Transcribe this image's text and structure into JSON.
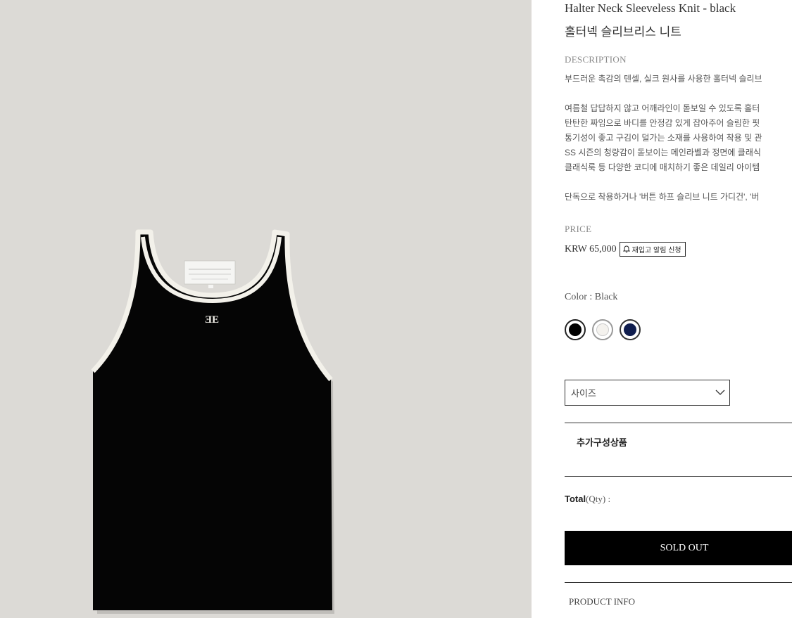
{
  "product": {
    "title_en": "Halter Neck Sleeveless Knit - black",
    "title_ko": "홀터넥 슬리브리스 니트",
    "image_alt": "black halter neck knit top",
    "label_text": "ƎE"
  },
  "description": {
    "heading": "DESCRIPTION",
    "lines": [
      "부드러운 촉감의 텐셀, 실크 원사를 사용한 홀터넥 슬리브",
      "",
      "여름철 답답하지 않고 어깨라인이 돋보일 수 있도록 홀터",
      "탄탄한 짜임으로 바디를 안정감 있게 잡아주어 슬림한 핏",
      "통기성이 좋고 구김이 덜가는 소재를 사용하여 착용 및 관",
      "SS 시즌의 청량감이 돋보이는 메인라벨과 정면에 클래식",
      "클래식룩 등 다양한 코디에 매치하기 좋은 데일리 아이템",
      "",
      "단독으로 착용하거나 '버튼 하프 슬리브 니트 가디건', '버"
    ]
  },
  "price": {
    "heading": "PRICE",
    "value": "KRW 65,000",
    "restock_button": "재입고 알림 신청",
    "restock_icon": "bell-icon"
  },
  "color": {
    "label": "Color : Black",
    "options": [
      {
        "name": "Black",
        "hex": "#000000",
        "selected": true
      },
      {
        "name": "White",
        "hex": "#f4f2ee",
        "selected": false
      },
      {
        "name": "Navy",
        "hex": "#0f1d4e",
        "selected": false
      }
    ]
  },
  "size": {
    "placeholder": "사이즈",
    "icon": "chevron-down-icon"
  },
  "addon": {
    "heading": "추가구성상품"
  },
  "total": {
    "label": "Total",
    "qty_label": "(Qty) :"
  },
  "buttons": {
    "sold_out": "SOLD OUT"
  },
  "product_info": {
    "heading": "PRODUCT INFO"
  },
  "colors": {
    "photo_bg": "#dcdad6",
    "sold_out_bg": "#000000",
    "trim": "#f3f1ea"
  }
}
